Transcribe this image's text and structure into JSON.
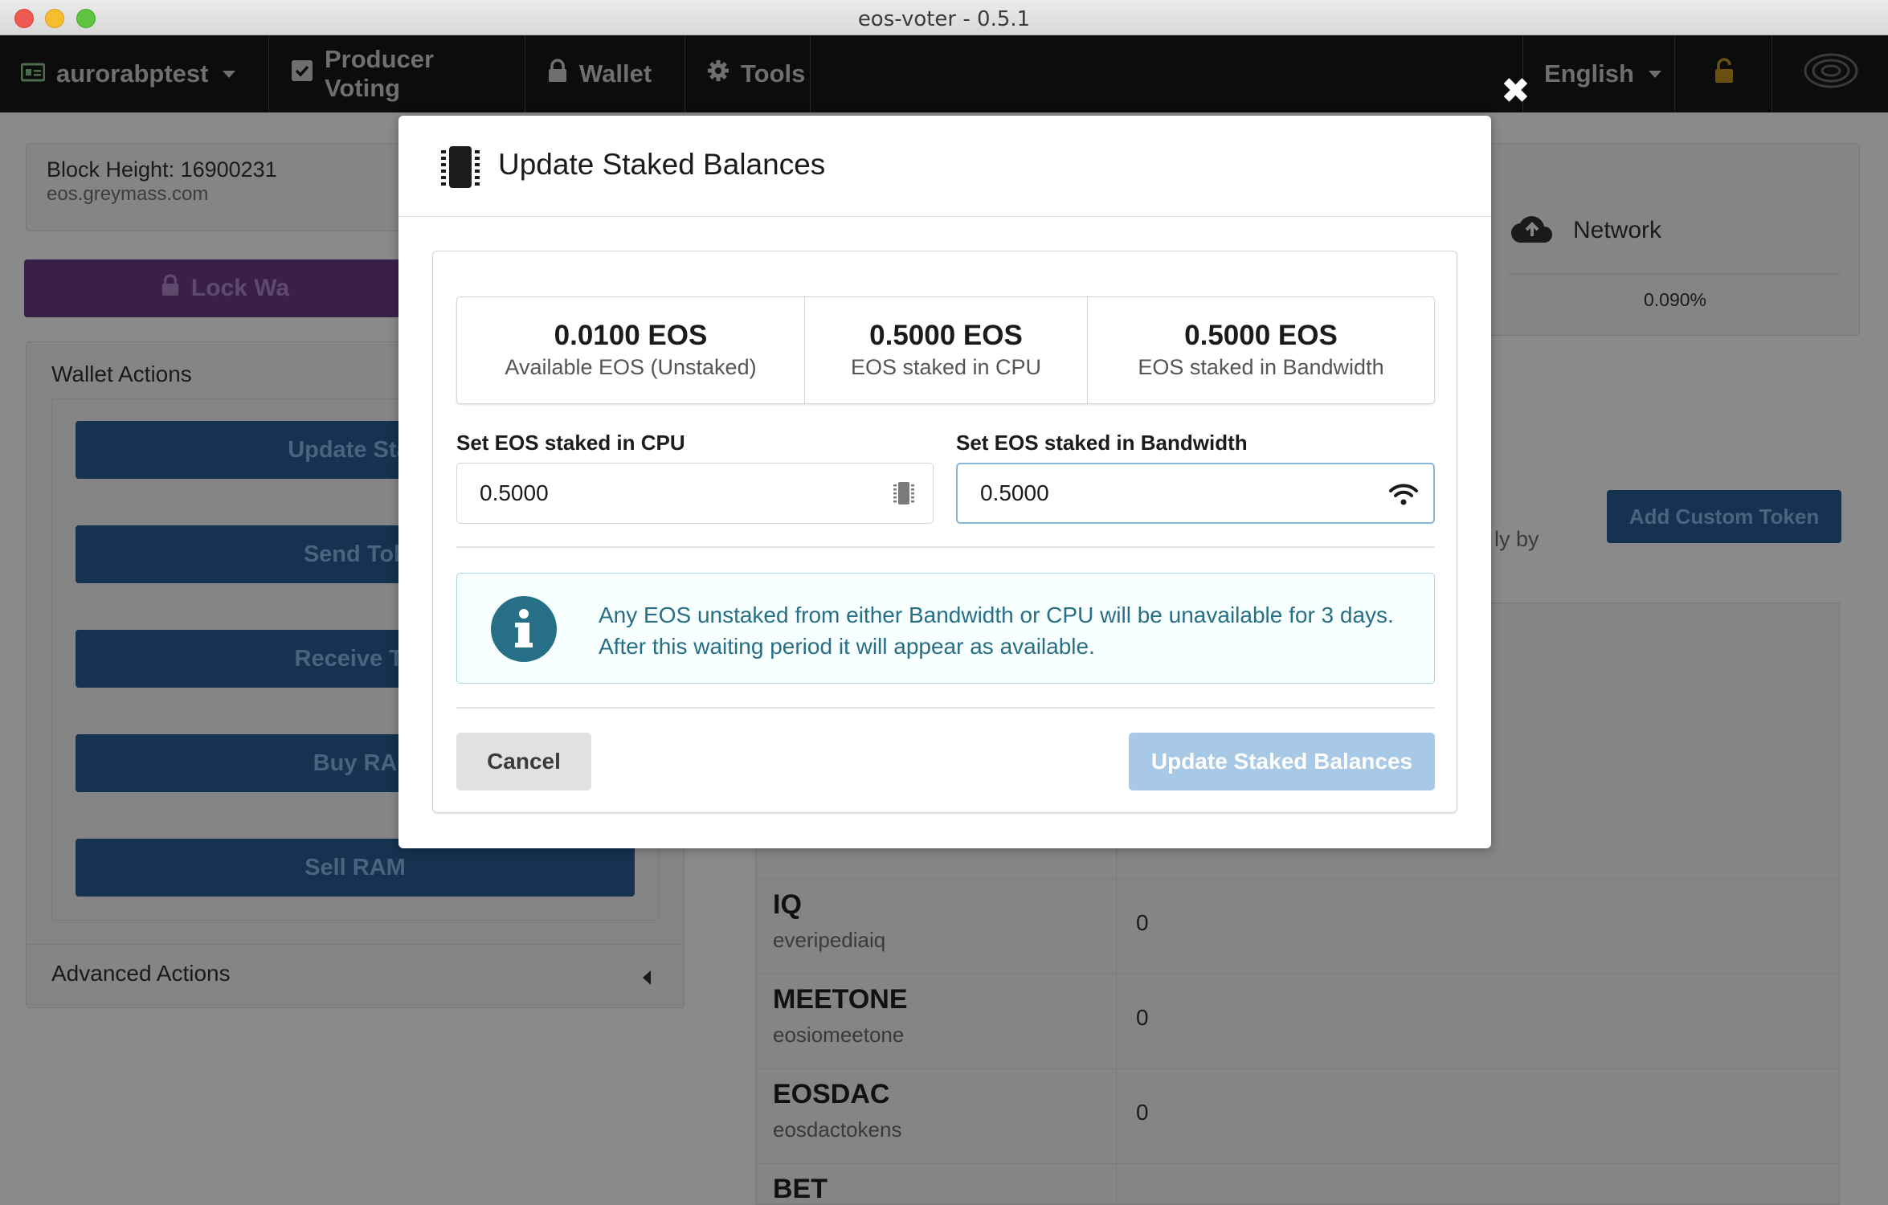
{
  "window": {
    "title": "eos-voter - 0.5.1"
  },
  "nav": {
    "account": "aurorabptest",
    "voting": "Producer Voting",
    "wallet": "Wallet",
    "tools": "Tools",
    "language": "English"
  },
  "background": {
    "block_height": "Block Height: 16900231",
    "node": "eos.greymass.com",
    "lock_wallet": "Lock Wa",
    "wallet_actions_title": "Wallet Actions",
    "actions": [
      "Update Stak",
      "Send Tok",
      "Receive To",
      "Buy RA",
      "Sell RAM"
    ],
    "advanced_actions": "Advanced Actions",
    "network_label": "Network",
    "network_pct": "0.090%",
    "partial_text": "ly by",
    "add_custom_token": "Add Custom Token",
    "tokens": [
      {
        "name": "IQ",
        "contract": "everipediaiq",
        "value": "0"
      },
      {
        "name": "MEETONE",
        "contract": "eosiomeetone",
        "value": "0"
      },
      {
        "name": "EOSDAC",
        "contract": "eosdactokens",
        "value": "0"
      },
      {
        "name": "BET",
        "contract": "",
        "value": ""
      }
    ]
  },
  "modal": {
    "title": "Update Staked Balances",
    "stats": [
      {
        "value": "0.0100 EOS",
        "label": "Available EOS (Unstaked)"
      },
      {
        "value": "0.5000 EOS",
        "label": "EOS staked in CPU"
      },
      {
        "value": "0.5000 EOS",
        "label": "EOS staked in Bandwidth"
      }
    ],
    "cpu_label": "Set EOS staked in CPU",
    "cpu_value": "0.5000",
    "bandwidth_label": "Set EOS staked in Bandwidth",
    "bandwidth_value": "0.5000",
    "info_line1": "Any EOS unstaked from either Bandwidth or CPU will be unavailable for 3 days.",
    "info_line2": "After this waiting period it will appear as available.",
    "cancel": "Cancel",
    "submit": "Update Staked Balances"
  },
  "colors": {
    "primary_disabled": "#a8c9e6",
    "info_text": "#276f86",
    "info_bg": "#f8ffff",
    "focus_border": "#85b7d9"
  },
  "icons": [
    "microchip-icon",
    "wifi-icon",
    "info-icon",
    "close-icon",
    "lock-icon",
    "cloud-upload-icon",
    "gear-icon",
    "check-square-icon",
    "id-card-icon"
  ]
}
